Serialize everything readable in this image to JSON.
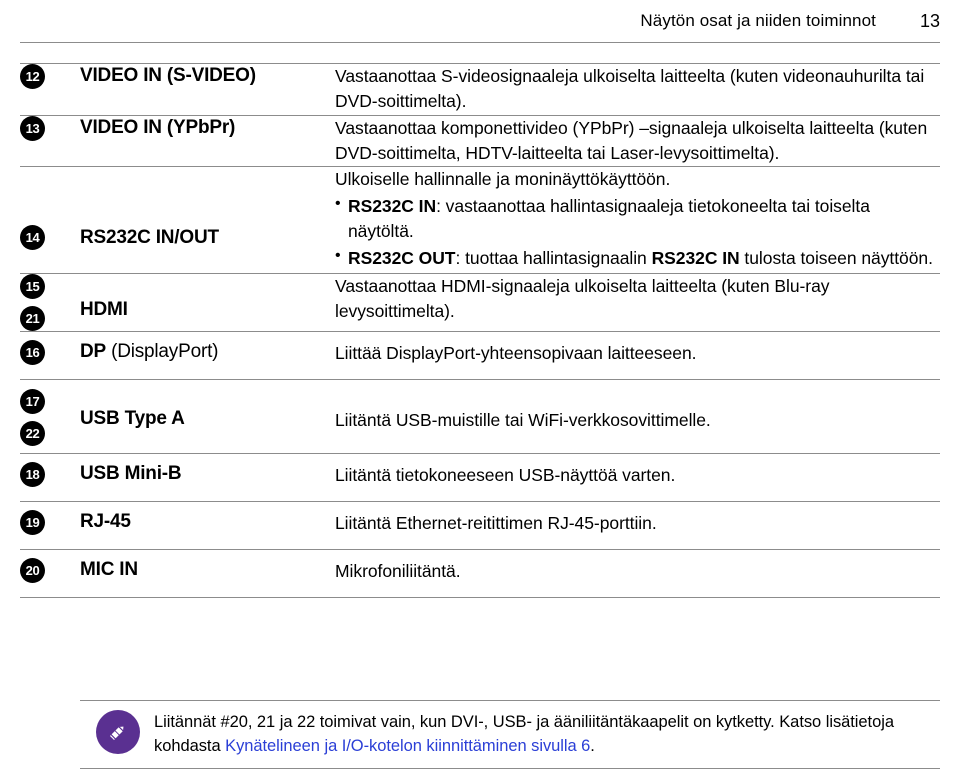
{
  "header": {
    "title": "Näytön osat ja niiden toiminnot",
    "page_number": "13"
  },
  "rows": [
    {
      "badges": [
        "12"
      ],
      "label": "VIDEO IN (S-VIDEO)",
      "label_suffix": "",
      "description": "Vastaanottaa S-videosignaaleja ulkoiselta laitteelta (kuten videonauhurilta tai DVD-soittimelta)."
    },
    {
      "badges": [
        "13"
      ],
      "label": "VIDEO IN (YPbPr)",
      "label_suffix": "",
      "description": "Vastaanottaa komponettivideo (YPbPr) –signaaleja ulkoiselta laitteelta (kuten DVD-soittimelta, HDTV-laitteelta tai Laser-levysoittimelta)."
    },
    {
      "badges": [
        "14"
      ],
      "label": "RS232C IN/OUT",
      "label_suffix": "",
      "description_intro": "Ulkoiselle hallinnalle ja moninäyttökäyttöön.",
      "bullets": [
        {
          "lead": "RS232C IN",
          "rest": ": vastaanottaa hallintasignaaleja tietokoneelta tai toiselta näytöltä."
        },
        {
          "lead": "RS232C OUT",
          "mid": ": tuottaa hallintasignaalin ",
          "lead2": "RS232C IN",
          "rest": " tulosta toiseen näyttöön."
        }
      ]
    },
    {
      "badges": [
        "15",
        "21"
      ],
      "label": "HDMI",
      "label_suffix": "",
      "description": "Vastaanottaa HDMI-signaaleja ulkoiselta laitteelta (kuten Blu-ray levysoittimelta)."
    },
    {
      "badges": [
        "16"
      ],
      "label": "DP",
      "label_suffix": " (DisplayPort)",
      "description": "Liittää DisplayPort-yhteensopivaan laitteeseen."
    },
    {
      "badges": [
        "17",
        "22"
      ],
      "label": "USB Type A",
      "label_suffix": "",
      "description": "Liitäntä USB-muistille tai WiFi-verkkosovittimelle."
    },
    {
      "badges": [
        "18"
      ],
      "label": "USB Mini-B",
      "label_suffix": "",
      "description": "Liitäntä tietokoneeseen USB-näyttöä varten."
    },
    {
      "badges": [
        "19"
      ],
      "label": "RJ-45",
      "label_suffix": "",
      "description": "Liitäntä Ethernet-reitittimen RJ-45-porttiin."
    },
    {
      "badges": [
        "20"
      ],
      "label": "MIC IN",
      "label_suffix": "",
      "description": "Mikrofoniliitäntä."
    }
  ],
  "note": {
    "icon": "pencil-icon",
    "icon_color": "#5a3091",
    "text_before": "Liitännät #20, 21 ja 22 toimivat vain, kun DVI-, USB- ja ääniliitäntäkaapelit on kytketty. Katso lisätietoja kohdasta ",
    "link_text": "Kynätelineen ja I/O-kotelon kiinnittäminen sivulla 6",
    "link_color": "#2b3fd6",
    "text_after": "."
  }
}
